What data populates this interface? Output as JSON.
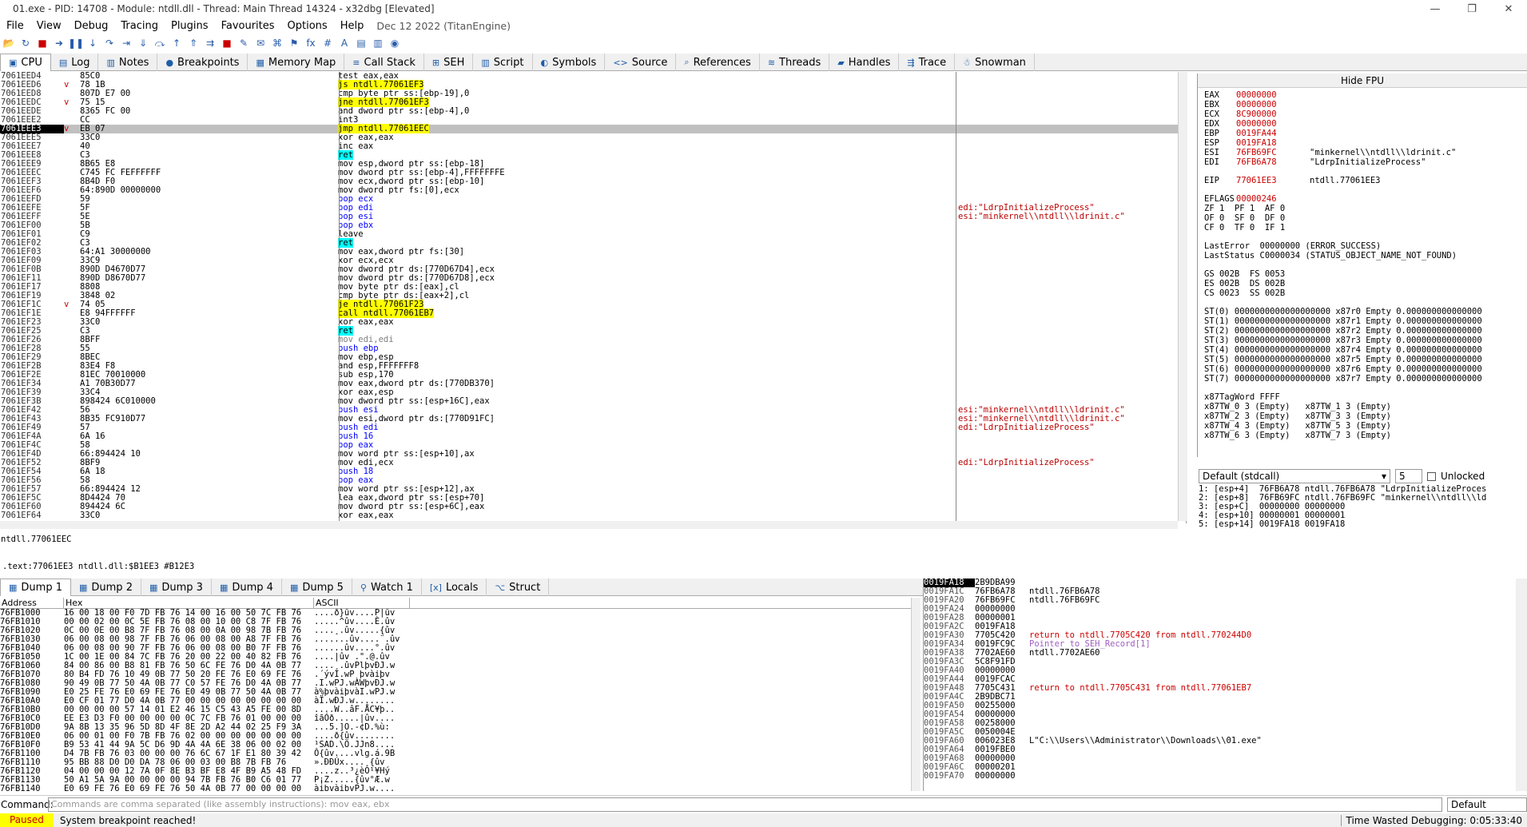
{
  "window": {
    "title": "01.exe - PID: 14708 - Module: ntdll.dll - Thread: Main Thread 14324 - x32dbg [Elevated]",
    "min": "—",
    "max": "❐",
    "close": "✕"
  },
  "menu": [
    "File",
    "View",
    "Debug",
    "Tracing",
    "Plugins",
    "Favourites",
    "Options",
    "Help"
  ],
  "menu_date": "Dec 12 2022 (TitanEngine)",
  "toolbar_icons": [
    "open-icon",
    "restart-icon",
    "stop-icon",
    "run-icon",
    "pause-icon",
    "step-into-icon",
    "step-over-icon",
    "run-to-user-icon",
    "trace-into-icon",
    "trace-over-icon",
    "execute-till-return-icon",
    "run-to-selection-icon",
    "animate-icon",
    "patch-icon",
    "scylla-icon",
    "comment-icon",
    "label-icon",
    "bookmark-icon",
    "function-icon",
    "hash-icon",
    "font-icon",
    "calculator-icon",
    "notes-icon",
    "graph-icon"
  ],
  "tabs": [
    {
      "label": "CPU",
      "icon": "cpu-icon"
    },
    {
      "label": "Log",
      "icon": "log-icon"
    },
    {
      "label": "Notes",
      "icon": "notes-icon"
    },
    {
      "label": "Breakpoints",
      "icon": "breakpoint-icon"
    },
    {
      "label": "Memory Map",
      "icon": "memory-icon"
    },
    {
      "label": "Call Stack",
      "icon": "callstack-icon"
    },
    {
      "label": "SEH",
      "icon": "seh-icon"
    },
    {
      "label": "Script",
      "icon": "script-icon"
    },
    {
      "label": "Symbols",
      "icon": "symbols-icon"
    },
    {
      "label": "Source",
      "icon": "source-icon"
    },
    {
      "label": "References",
      "icon": "references-icon"
    },
    {
      "label": "Threads",
      "icon": "threads-icon"
    },
    {
      "label": "Handles",
      "icon": "handles-icon"
    },
    {
      "label": "Trace",
      "icon": "trace-icon"
    },
    {
      "label": "Snowman",
      "icon": "snowman-icon"
    }
  ],
  "disasm": [
    [
      "7061EED4",
      "",
      "85C0",
      "test eax,eax",
      "",
      ""
    ],
    [
      "7061EED6",
      "v",
      "78 1B",
      "js ntdll.77061EF3",
      "jmp",
      ""
    ],
    [
      "7061EED8",
      "",
      "807D E7 00",
      "cmp byte ptr ss:[ebp-19],0",
      "",
      ""
    ],
    [
      "7061EEDC",
      "v",
      "75 15",
      "jne ntdll.77061EF3",
      "jmp",
      ""
    ],
    [
      "7061EEDE",
      "",
      "8365 FC 00",
      "and dword ptr ss:[ebp-4],0",
      "",
      ""
    ],
    [
      "7061EEE2",
      "",
      "CC",
      "int3",
      "",
      ""
    ],
    [
      "7061EEE3",
      "v",
      "EB 07",
      "jmp ntdll.77061EEC",
      "jmp",
      "sel"
    ],
    [
      "7061EEE5",
      "",
      "33C0",
      "xor eax,eax",
      "",
      ""
    ],
    [
      "7061EEE7",
      "",
      "40",
      "inc eax",
      "",
      ""
    ],
    [
      "7061EEE8",
      "",
      "C3",
      "ret",
      "ret",
      ""
    ],
    [
      "7061EEE9",
      "",
      "8B65 E8",
      "mov esp,dword ptr ss:[ebp-18]",
      "",
      ""
    ],
    [
      "7061EEEC",
      "",
      "C745 FC FEFFFFFF",
      "mov dword ptr ss:[ebp-4],FFFFFFFE",
      "",
      ""
    ],
    [
      "7061EEF3",
      "",
      "8B4D F0",
      "mov ecx,dword ptr ss:[ebp-10]",
      "",
      ""
    ],
    [
      "7061EEF6",
      "",
      "64:890D 00000000",
      "mov dword ptr fs:[0],ecx",
      "",
      ""
    ],
    [
      "7061EEFD",
      "",
      "59",
      "pop ecx",
      "pop",
      ""
    ],
    [
      "7061EEFE",
      "",
      "5F",
      "pop edi",
      "pop",
      "edi:\"LdrpInitializeProcess\""
    ],
    [
      "7061EEFF",
      "",
      "5E",
      "pop esi",
      "pop",
      "esi:\"minkernel\\\\ntdll\\\\ldrinit.c\""
    ],
    [
      "7061EF00",
      "",
      "5B",
      "pop ebx",
      "pop",
      ""
    ],
    [
      "7061EF01",
      "",
      "C9",
      "leave",
      "",
      ""
    ],
    [
      "7061EF02",
      "",
      "C3",
      "ret",
      "ret",
      ""
    ],
    [
      "7061EF03",
      "",
      "64:A1 30000000",
      "mov eax,dword ptr fs:[30]",
      "",
      ""
    ],
    [
      "7061EF09",
      "",
      "33C9",
      "xor ecx,ecx",
      "",
      ""
    ],
    [
      "7061EF0B",
      "",
      "890D D4670D77",
      "mov dword ptr ds:[770D67D4],ecx",
      "",
      ""
    ],
    [
      "7061EF11",
      "",
      "890D D8670D77",
      "mov dword ptr ds:[770D67D8],ecx",
      "",
      ""
    ],
    [
      "7061EF17",
      "",
      "8808",
      "mov byte ptr ds:[eax],cl",
      "",
      ""
    ],
    [
      "7061EF19",
      "",
      "3848 02",
      "cmp byte ptr ds:[eax+2],cl",
      "",
      ""
    ],
    [
      "7061EF1C",
      "v",
      "74 05",
      "je ntdll.77061F23",
      "jmp",
      ""
    ],
    [
      "7061EF1E",
      "",
      "E8 94FFFFFF",
      "call ntdll.77061EB7",
      "call",
      ""
    ],
    [
      "7061EF23",
      "",
      "33C0",
      "xor eax,eax",
      "",
      ""
    ],
    [
      "7061EF25",
      "",
      "C3",
      "ret",
      "ret",
      ""
    ],
    [
      "7061EF26",
      "",
      "8BFF",
      "mov edi,edi",
      "nop",
      ""
    ],
    [
      "7061EF28",
      "",
      "55",
      "push ebp",
      "push",
      ""
    ],
    [
      "7061EF29",
      "",
      "8BEC",
      "mov ebp,esp",
      "",
      ""
    ],
    [
      "7061EF2B",
      "",
      "83E4 F8",
      "and esp,FFFFFFF8",
      "",
      ""
    ],
    [
      "7061EF2E",
      "",
      "81EC 70010000",
      "sub esp,170",
      "",
      ""
    ],
    [
      "7061EF34",
      "",
      "A1 70B30D77",
      "mov eax,dword ptr ds:[770DB370]",
      "",
      ""
    ],
    [
      "7061EF39",
      "",
      "33C4",
      "xor eax,esp",
      "",
      ""
    ],
    [
      "7061EF3B",
      "",
      "898424 6C010000",
      "mov dword ptr ss:[esp+16C],eax",
      "",
      ""
    ],
    [
      "7061EF42",
      "",
      "56",
      "push esi",
      "push",
      "esi:\"minkernel\\\\ntdll\\\\ldrinit.c\""
    ],
    [
      "7061EF43",
      "",
      "8B35 FC910D77",
      "mov esi,dword ptr ds:[770D91FC]",
      "",
      "esi:\"minkernel\\\\ntdll\\\\ldrinit.c\""
    ],
    [
      "7061EF49",
      "",
      "57",
      "push edi",
      "push",
      "edi:\"LdrpInitializeProcess\""
    ],
    [
      "7061EF4A",
      "",
      "6A 16",
      "push 16",
      "push",
      ""
    ],
    [
      "7061EF4C",
      "",
      "58",
      "pop eax",
      "pop",
      ""
    ],
    [
      "7061EF4D",
      "",
      "66:894424 10",
      "mov word ptr ss:[esp+10],ax",
      "",
      ""
    ],
    [
      "7061EF52",
      "",
      "8BF9",
      "mov edi,ecx",
      "",
      "edi:\"LdrpInitializeProcess\""
    ],
    [
      "7061EF54",
      "",
      "6A 18",
      "push 18",
      "push",
      ""
    ],
    [
      "7061EF56",
      "",
      "58",
      "pop eax",
      "pop",
      ""
    ],
    [
      "7061EF57",
      "",
      "66:894424 12",
      "mov word ptr ss:[esp+12],ax",
      "",
      ""
    ],
    [
      "7061EF5C",
      "",
      "8D4424 70",
      "lea eax,dword ptr ss:[esp+70]",
      "",
      ""
    ],
    [
      "7061EF60",
      "",
      "894424 6C",
      "mov dword ptr ss:[esp+6C],eax",
      "",
      ""
    ],
    [
      "7061EF64",
      "",
      "33C0",
      "xor eax,eax",
      "",
      ""
    ]
  ],
  "info_line1": "ntdll.77061EEC",
  "info_line2": ".text:77061EE3 ntdll.dll:$B1EE3 #B12E3",
  "fpu": {
    "toggle": "Hide FPU",
    "regs": [
      [
        "EAX",
        "00000000",
        ""
      ],
      [
        "EBX",
        "00000000",
        ""
      ],
      [
        "ECX",
        "8C900000",
        ""
      ],
      [
        "EDX",
        "00000000",
        ""
      ],
      [
        "EBP",
        "0019FA44",
        ""
      ],
      [
        "ESP",
        "0019FA18",
        ""
      ],
      [
        "ESI",
        "76FB69FC",
        "\"minkernel\\\\ntdll\\\\ldrinit.c\""
      ],
      [
        "EDI",
        "76FB6A78",
        "\"LdrpInitializeProcess\""
      ]
    ],
    "eip": [
      "EIP",
      "77061EE3",
      "ntdll.77061EE3"
    ],
    "eflags": [
      "EFLAGS",
      "00000246"
    ],
    "flags": [
      "ZF 1  PF 1  AF 0",
      "OF 0  SF 0  DF 0",
      "CF 0  TF 0  IF 1"
    ],
    "lasterror": "LastError  00000000 (ERROR_SUCCESS)",
    "laststatus": "LastStatus C0000034 (STATUS_OBJECT_NAME_NOT_FOUND)",
    "segs": [
      "GS 002B  FS 0053",
      "ES 002B  DS 002B",
      "CS 0023  SS 002B"
    ],
    "st": [
      "ST(0) 0000000000000000000 x87r0 Empty 0.000000000000000",
      "ST(1) 0000000000000000000 x87r1 Empty 0.000000000000000",
      "ST(2) 0000000000000000000 x87r2 Empty 0.000000000000000",
      "ST(3) 0000000000000000000 x87r3 Empty 0.000000000000000",
      "ST(4) 0000000000000000000 x87r4 Empty 0.000000000000000",
      "ST(5) 0000000000000000000 x87r5 Empty 0.000000000000000",
      "ST(6) 0000000000000000000 x87r6 Empty 0.000000000000000",
      "ST(7) 0000000000000000000 x87r7 Empty 0.000000000000000"
    ],
    "tag": [
      "x87TagWord FFFF",
      "x87TW_0 3 (Empty)   x87TW_1 3 (Empty)",
      "x87TW_2 3 (Empty)   x87TW_3 3 (Empty)",
      "x87TW_4 3 (Empty)   x87TW_5 3 (Empty)",
      "x87TW_6 3 (Empty)   x87TW_7 3 (Empty)"
    ]
  },
  "callconv": {
    "value": "Default (stdcall)",
    "count": "5",
    "unlocked": "Unlocked"
  },
  "stackargs": [
    "1: [esp+4]  76FB6A78 ntdll.76FB6A78 \"LdrpInitializeProces",
    "2: [esp+8]  76FB69FC ntdll.76FB69FC \"minkernel\\\\ntdll\\\\ld",
    "3: [esp+C]  00000000 00000000",
    "4: [esp+10] 00000001 00000001",
    "5: [esp+14] 0019FA18 0019FA18"
  ],
  "bottomtabs": [
    {
      "label": "Dump 1",
      "icon": "dump-icon"
    },
    {
      "label": "Dump 2",
      "icon": "dump-icon"
    },
    {
      "label": "Dump 3",
      "icon": "dump-icon"
    },
    {
      "label": "Dump 4",
      "icon": "dump-icon"
    },
    {
      "label": "Dump 5",
      "icon": "dump-icon"
    },
    {
      "label": "Watch 1",
      "icon": "watch-icon"
    },
    {
      "label": "Locals",
      "icon": "locals-icon"
    },
    {
      "label": "Struct",
      "icon": "struct-icon"
    }
  ],
  "dumphdr": {
    "address": "Address",
    "hex": "Hex",
    "ascii": "ASCII"
  },
  "dump": [
    [
      "76FB1000",
      "16 00 18 00 F0 7D FB 76 14 00 16 00 50 7C FB 76",
      "....ð}ûv....P|ûv"
    ],
    [
      "76FB1010",
      "00 00 02 00 0C 5E FB 76 08 00 10 00 C8 7F FB 76",
      ".....^ûv....È.ûv"
    ],
    [
      "76FB1020",
      "0C 00 0E 00 B8 7F FB 76 08 00 0A 00 98 7B FB 76",
      "....¸.ûv.....{ûv"
    ],
    [
      "76FB1030",
      "06 00 08 00 98 7F FB 76 06 00 08 00 A8 7F FB 76",
      ".......ûv....¨.ûv"
    ],
    [
      "76FB1040",
      "06 00 08 00 90 7F FB 76 06 00 08 00 B0 7F FB 76",
      "......ûv....°.ûv"
    ],
    [
      "76FB1050",
      "1C 00 1E 00 84 7C FB 76 20 00 22 00 40 82 FB 76",
      "....|ûv .\".@.ûv"
    ],
    [
      "76FB1060",
      "84 00 86 00 B8 81 FB 76 50 6C FE 76 D0 4A 0B 77",
      "....¸.ûvPlþvÐJ.w"
    ],
    [
      "76FB1070",
      "80 B4 FD 76 10 49 0B 77 50 20 FE 76 E0 69 FE 76",
      ".´ývI.wP þvàiþv"
    ],
    [
      "76FB1080",
      "90 49 0B 77 50 4A 0B 77 C0 57 FE 76 D0 4A 0B 77",
      ".I.wPJ.wÀWþvÐJ.w"
    ],
    [
      "76FB1090",
      "E0 25 FE 76 E0 69 FE 76 E0 49 0B 77 50 4A 0B 77",
      "à%þvàiþvàI.wPJ.w"
    ],
    [
      "76FB10A0",
      "E0 CF 01 77 D0 4A 0B 77 00 00 00 00 00 00 00 00",
      "àÏ.wÐJ.w........"
    ],
    [
      "76FB10B0",
      "00 00 00 00 57 14 01 E2 46 15 C5 43 A5 FE 00 8D",
      "....W..âF.ÅC¥þ.."
    ],
    [
      "76FB10C0",
      "EE E3 D3 F0 00 00 00 00 0C 7C FB 76 01 00 00 00",
      "îãÓð.....|ûv...."
    ],
    [
      "76FB10D0",
      "9A 8B 13 35 96 5D 8D 4F 8E 2D A2 44 02 25 F9 3A",
      "...5.]O.-¢D.%ù:"
    ],
    [
      "76FB10E0",
      "06 00 01 00 F0 7B FB 76 02 00 00 00 00 00 00 00",
      "....ð{ûv........"
    ],
    [
      "76FB10F0",
      "B9 53 41 44 9A 5C D6 9D 4A 4A 6E 38 06 00 02 00",
      "¹SAD.\\Ö.JJn8...."
    ],
    [
      "76FB1100",
      "D4 7B FB 76 03 00 00 00 76 6C 67 1F E1 80 39 42",
      "Ô{ûv....vlg.á.9B"
    ],
    [
      "76FB1110",
      "95 BB 88 D0 D0 DA 78 06 00 03 00 B8 7B FB 76",
      "».ÐÐÚx....¸{ûv"
    ],
    [
      "76FB1120",
      "04 00 00 00 12 7A 0F 8E B3 BF E8 4F B9 A5 48 FD",
      "....z..³¿èO¹¥Hý"
    ],
    [
      "76FB1130",
      "50 A1 5A 9A 00 00 00 00 94 7B FB 76 B0 C6 01 77",
      "P¡Z.....{ûv°Æ.w"
    ],
    [
      "76FB1140",
      "E0 69 FE 76 E0 69 FE 76 50 4A 0B 77 00 00 00 00",
      "àiþvàiþvPJ.w...."
    ]
  ],
  "stack": [
    [
      "0019FA18",
      "2B9DBA99",
      "",
      "",
      true
    ],
    [
      "0019FA1C",
      "76FB6A78",
      "ntdll.76FB6A78",
      "",
      false
    ],
    [
      "0019FA20",
      "76FB69FC",
      "ntdll.76FB69FC",
      "",
      false
    ],
    [
      "0019FA24",
      "00000000",
      "",
      "",
      false
    ],
    [
      "0019FA28",
      "00000001",
      "",
      "",
      false
    ],
    [
      "0019FA2C",
      "0019FA18",
      "",
      "",
      false
    ],
    [
      "0019FA30",
      "7705C420",
      "return to ntdll.7705C420 from ntdll.770244D0",
      "red",
      false
    ],
    [
      "0019FA34",
      "0019FC9C",
      "Pointer to SEH_Record[1]",
      "pur",
      false
    ],
    [
      "0019FA38",
      "7702AE60",
      "ntdll.7702AE60",
      "",
      false
    ],
    [
      "0019FA3C",
      "5C8F91FD",
      "",
      "",
      false
    ],
    [
      "0019FA40",
      "00000000",
      "",
      "",
      false
    ],
    [
      "0019FA44",
      "0019FCAC",
      "",
      "",
      false
    ],
    [
      "0019FA48",
      "7705C431",
      "return to ntdll.7705C431 from ntdll.77061EB7",
      "red",
      false
    ],
    [
      "0019FA4C",
      "2B9DBC71",
      "",
      "",
      false
    ],
    [
      "0019FA50",
      "00255000",
      "",
      "",
      false
    ],
    [
      "0019FA54",
      "00000000",
      "",
      "",
      false
    ],
    [
      "0019FA58",
      "00258000",
      "",
      "",
      false
    ],
    [
      "0019FA5C",
      "0050004E",
      "",
      "",
      false
    ],
    [
      "0019FA60",
      "006023E8",
      "L\"C:\\\\Users\\\\Administrator\\\\Downloads\\\\01.exe\"",
      "",
      false
    ],
    [
      "0019FA64",
      "0019FBE0",
      "",
      "",
      false
    ],
    [
      "0019FA68",
      "00000000",
      "",
      "",
      false
    ],
    [
      "0019FA6C",
      "00000201",
      "",
      "",
      false
    ],
    [
      "0019FA70",
      "00000000",
      "",
      "",
      false
    ]
  ],
  "cmd": {
    "label": "Command:",
    "placeholder": "Commands are comma separated (like assembly instructions): mov eax, ebx",
    "mode": "Default"
  },
  "status": {
    "state": "Paused",
    "message": "System breakpoint reached!",
    "time": "Time Wasted Debugging: 0:05:33:40"
  }
}
